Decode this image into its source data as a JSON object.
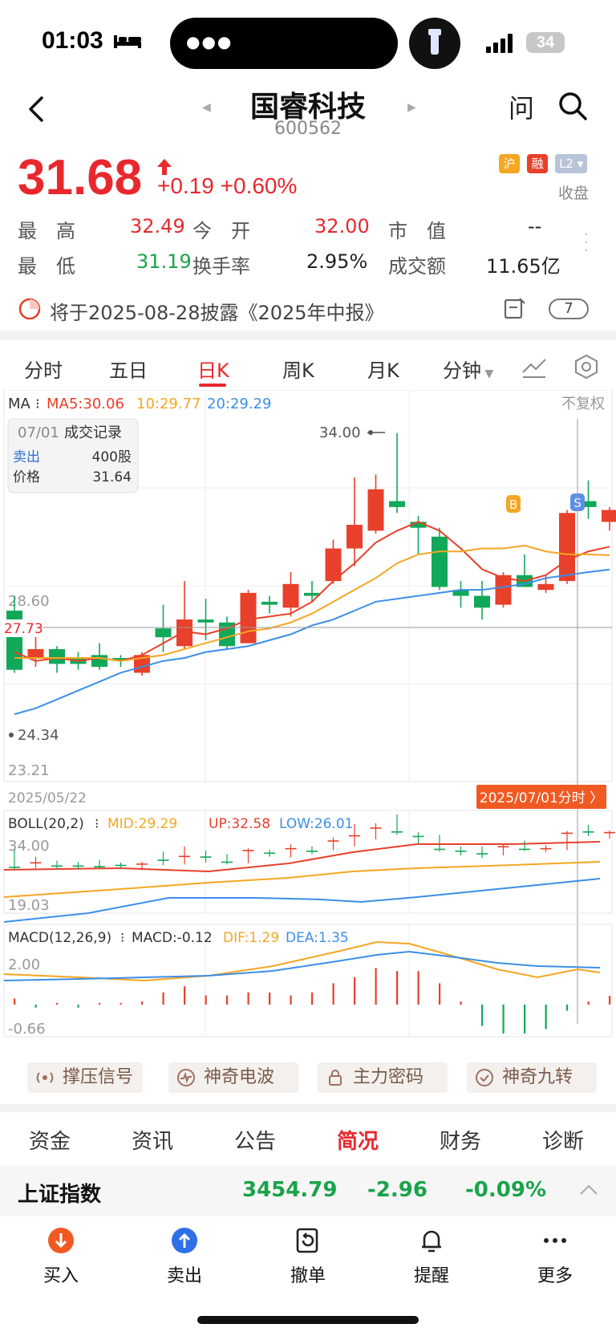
{
  "status": {
    "time": "01:03",
    "battery": "34"
  },
  "header": {
    "name": "国睿科技",
    "code": "600562",
    "ask": "问"
  },
  "quote": {
    "price": "31.68",
    "change": "+0.19",
    "change_pct": "+0.60%",
    "badges": [
      "沪",
      "融",
      "L2"
    ],
    "state": "收盘",
    "rows": [
      [
        {
          "label": "最　高",
          "value": "32.49"
        },
        {
          "label": "今　开",
          "value": "32.00"
        },
        {
          "label": "市　值",
          "value": "--"
        }
      ],
      [
        {
          "label": "最　低",
          "value": "31.19"
        },
        {
          "label": "换手率",
          "value": "2.95%"
        },
        {
          "label": "成交额",
          "value": "11.65亿"
        }
      ]
    ]
  },
  "notice": {
    "text": "将于2025-08-28披露《2025年中报》",
    "count": "7"
  },
  "chart_tabs": [
    "分时",
    "五日",
    "日K",
    "周K",
    "月K",
    "分钟"
  ],
  "chart_labels": {
    "ma_prefix": "MA",
    "ma5": "MA5:30.06",
    "ma10": "10:29.77",
    "ma20": "20:29.29",
    "adjust": "不复权",
    "tooltip_date": "07/01",
    "tooltip_title": "成交记录",
    "tooltip_side": "卖出",
    "tooltip_qty": "400股",
    "tooltip_price_label": "价格",
    "tooltip_price": "31.64",
    "max_label": "34.00",
    "min_label": "24.34",
    "y_mid": "28.60",
    "y_low": "23.21",
    "crosshair_price": "27.73",
    "start_date": "2025/05/22",
    "cursor_date": "2025/07/01分时 〉",
    "marker_b": "B",
    "marker_s": "S",
    "boll_name": "BOLL(20,2)",
    "boll_mid": "MID:29.29",
    "boll_up": "UP:32.58",
    "boll_low": "LOW:26.01",
    "boll_top": "34.00",
    "boll_bottom": "19.03",
    "macd_name": "MACD(12,26,9)",
    "macd_val": "MACD:-0.12",
    "macd_dif": "DIF:1.29",
    "macd_dea": "DEA:1.35",
    "macd_top": "2.00",
    "macd_bottom": "-0.66"
  },
  "chart_data": {
    "type": "candlestick",
    "candles": [
      {
        "o": 27.9,
        "c": 25.9,
        "h": 28.4,
        "l": 25.8
      },
      {
        "o": 26.3,
        "c": 26.6,
        "h": 27.3,
        "l": 26.0
      },
      {
        "o": 26.6,
        "c": 26.1,
        "h": 26.7,
        "l": 25.8
      },
      {
        "o": 26.3,
        "c": 26.1,
        "h": 26.5,
        "l": 25.9
      },
      {
        "o": 26.4,
        "c": 26.0,
        "h": 26.8,
        "l": 25.9
      },
      {
        "o": 26.3,
        "c": 26.2,
        "h": 26.4,
        "l": 26.0
      },
      {
        "o": 25.8,
        "c": 26.4,
        "h": 26.5,
        "l": 25.7
      },
      {
        "o": 27.3,
        "c": 27.0,
        "h": 28.1,
        "l": 26.5
      },
      {
        "o": 26.7,
        "c": 27.6,
        "h": 28.9,
        "l": 26.6
      },
      {
        "o": 27.6,
        "c": 27.5,
        "h": 28.3,
        "l": 26.9
      },
      {
        "o": 27.5,
        "c": 26.7,
        "h": 27.7,
        "l": 26.6
      },
      {
        "o": 26.8,
        "c": 28.5,
        "h": 28.6,
        "l": 26.8
      },
      {
        "o": 28.2,
        "c": 28.1,
        "h": 28.4,
        "l": 27.8
      },
      {
        "o": 28.0,
        "c": 28.8,
        "h": 29.2,
        "l": 27.7
      },
      {
        "o": 28.5,
        "c": 28.4,
        "h": 28.9,
        "l": 28.2
      },
      {
        "o": 28.9,
        "c": 30.0,
        "h": 30.3,
        "l": 28.8
      },
      {
        "o": 30.0,
        "c": 30.8,
        "h": 32.4,
        "l": 29.4
      },
      {
        "o": 30.6,
        "c": 32.0,
        "h": 32.5,
        "l": 30.5
      },
      {
        "o": 31.6,
        "c": 31.4,
        "h": 33.9,
        "l": 31.2
      },
      {
        "o": 30.9,
        "c": 30.7,
        "h": 31.1,
        "l": 29.8
      },
      {
        "o": 30.4,
        "c": 28.7,
        "h": 30.7,
        "l": 28.6
      },
      {
        "o": 28.6,
        "c": 28.4,
        "h": 28.9,
        "l": 28.0
      },
      {
        "o": 28.4,
        "c": 28.0,
        "h": 28.9,
        "l": 27.6
      },
      {
        "o": 28.1,
        "c": 29.1,
        "h": 29.2,
        "l": 28.0
      },
      {
        "o": 29.1,
        "c": 28.7,
        "h": 29.8,
        "l": 28.7
      },
      {
        "o": 28.6,
        "c": 28.8,
        "h": 29.1,
        "l": 28.5
      },
      {
        "o": 28.9,
        "c": 31.2,
        "h": 31.3,
        "l": 28.8
      },
      {
        "o": 31.6,
        "c": 31.4,
        "h": 32.3,
        "l": 31.0
      },
      {
        "o": 30.9,
        "c": 31.3,
        "h": 31.4,
        "l": 30.6
      }
    ],
    "ma5": [
      26.5,
      26.2,
      26.3,
      26.2,
      26.3,
      26.2,
      26.4,
      26.8,
      27.2,
      27.1,
      27.3,
      27.6,
      27.7,
      27.8,
      28.2,
      28.9,
      29.5,
      30.2,
      30.6,
      30.9,
      30.6,
      30.0,
      29.3,
      29.0,
      28.9,
      29.1,
      29.6,
      29.9,
      30.06
    ],
    "ma10": [
      26.3,
      26.3,
      26.3,
      26.3,
      26.3,
      26.2,
      26.3,
      26.4,
      26.6,
      26.8,
      27.0,
      27.2,
      27.3,
      27.5,
      27.8,
      28.2,
      28.6,
      29.0,
      29.5,
      29.8,
      29.9,
      29.9,
      30.0,
      30.0,
      30.1,
      29.9,
      29.8,
      29.8,
      29.77
    ],
    "ma20": [
      24.4,
      24.6,
      24.9,
      25.2,
      25.5,
      25.8,
      26.0,
      26.2,
      26.3,
      26.5,
      26.6,
      26.7,
      26.9,
      27.1,
      27.4,
      27.6,
      27.9,
      28.2,
      28.3,
      28.4,
      28.5,
      28.6,
      28.6,
      28.7,
      28.8,
      29.0,
      29.1,
      29.2,
      29.29
    ],
    "ylim": [
      23.21,
      34.0
    ]
  },
  "features": [
    "撑压信号",
    "神奇电波",
    "主力密码",
    "神奇九转"
  ],
  "info_tabs": [
    "资金",
    "资讯",
    "公告",
    "简况",
    "财务",
    "诊断"
  ],
  "index": {
    "name": "上证指数",
    "value": "3454.79",
    "change": "-2.96",
    "pct": "-0.09%"
  },
  "bottom_nav": [
    "买入",
    "卖出",
    "撤单",
    "提醒",
    "更多"
  ],
  "colors": {
    "up": "#e8402a",
    "down": "#12a85a",
    "ma5": "#e8402a",
    "ma10": "#f5a623",
    "ma20": "#3b8fe8",
    "accent": "#e8282d"
  }
}
